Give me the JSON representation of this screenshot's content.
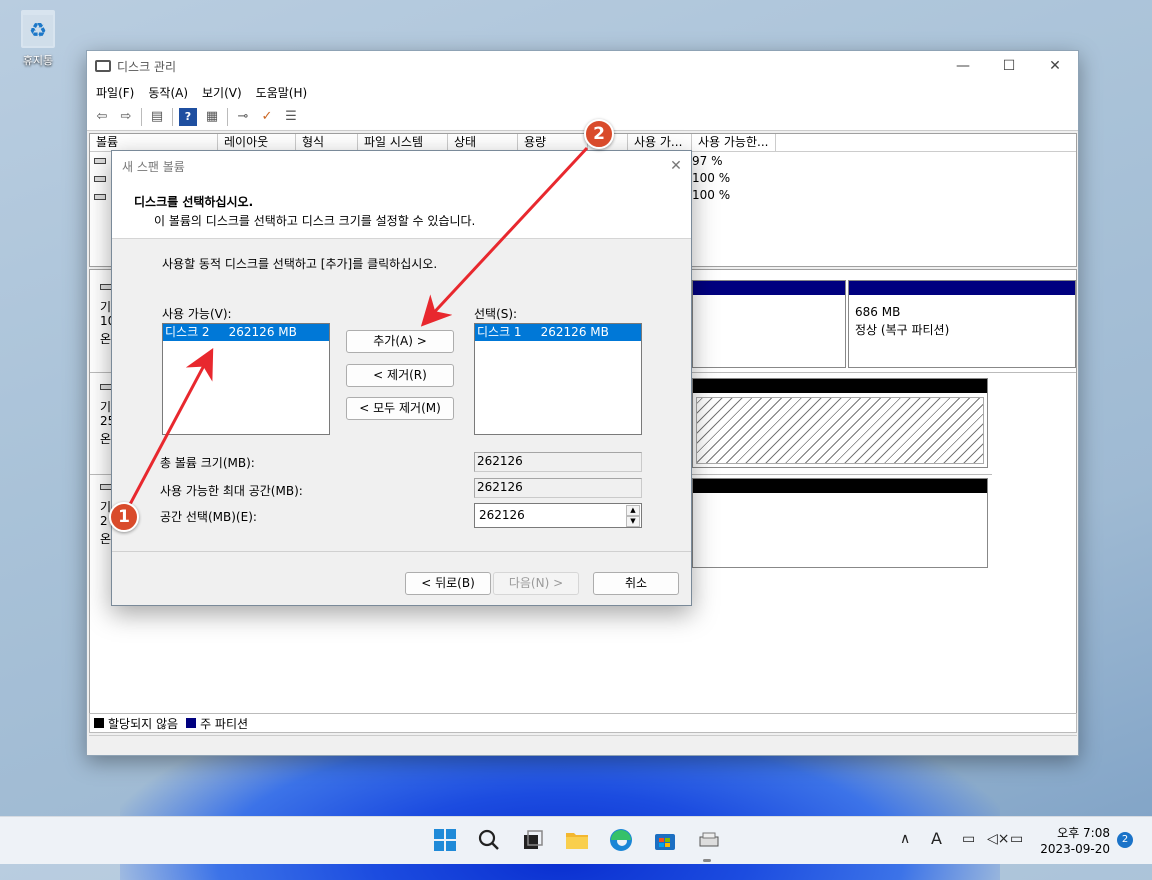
{
  "desktop": {
    "recycle_bin_label": "휴지통"
  },
  "window": {
    "title": "디스크 관리",
    "menu": [
      "파일(F)",
      "동작(A)",
      "보기(V)",
      "도움말(H)"
    ],
    "columns": [
      "볼륨",
      "레이아웃",
      "형식",
      "파일 시스템",
      "상태",
      "용량",
      "",
      "사용 가...",
      "사용 가능한..."
    ],
    "volume_rows": [
      {
        "free_pct": "97 %"
      },
      {
        "free_pct": "100 %"
      },
      {
        "free_pct": "100 %"
      }
    ],
    "disks": [
      {
        "line1": "기",
        "line2": "10",
        "line3": "온"
      },
      {
        "line1": "기",
        "line2": "25",
        "line3": "온"
      },
      {
        "line1": "기",
        "line2": "2",
        "line3": "온"
      }
    ],
    "recovery_partition": {
      "size": "686 MB",
      "status": "정상 (복구 파티션)"
    },
    "legend": {
      "unallocated": "할당되지 않음",
      "primary": "주 파티션"
    },
    "colors": {
      "primary": "#00007f",
      "unallocated": "#000000"
    }
  },
  "dialog": {
    "title": "새 스팬 볼륨",
    "header_title": "디스크를 선택하십시오.",
    "header_subtitle": "이 볼륨의 디스크를 선택하고 디스크 크기를 설정할 수 있습니다.",
    "instruction": "사용할 동적 디스크를 선택하고 [추가]를 클릭하십시오.",
    "available_label": "사용 가능(V):",
    "available_items": [
      "디스크 2     262126 MB"
    ],
    "selected_label": "선택(S):",
    "selected_items": [
      "디스크 1     262126 MB"
    ],
    "add_button": "추가(A) >",
    "remove_button": "< 제거(R)",
    "remove_all_button": "< 모두 제거(M)",
    "total_size_label": "총 볼륨 크기(MB):",
    "total_size_value": "262126",
    "max_space_label": "사용 가능한 최대 공간(MB):",
    "max_space_value": "262126",
    "space_select_label": "공간 선택(MB)(E):",
    "space_select_value": "262126",
    "back_button": "< 뒤로(B)",
    "next_button": "다음(N) >",
    "cancel_button": "취소"
  },
  "annotations": {
    "step1": "1",
    "step2": "2",
    "arrow_color": "#e8282e"
  },
  "taskbar": {
    "icons": [
      "windows-start-icon",
      "search-icon",
      "task-view-icon",
      "file-explorer-icon",
      "edge-icon",
      "store-icon",
      "disk-management-icon"
    ],
    "tray_icons": [
      "chevron-up-icon",
      "ime-icon",
      "network-icon",
      "volume-mute-icon",
      "battery-icon"
    ],
    "ime_label": "A",
    "time": "오후 7:08",
    "date": "2023-09-20",
    "notification_count": "2"
  }
}
